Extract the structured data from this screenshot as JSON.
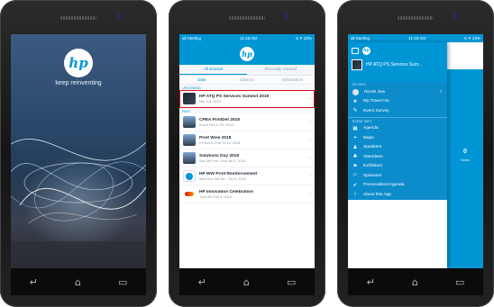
{
  "phone1": {
    "logo_text": "hp",
    "tagline": "keep reinventing",
    "nav": [
      "↵",
      "⌂",
      "▭"
    ]
  },
  "phone2": {
    "status_left": "all Sterling",
    "status_time": "11:49 AM",
    "status_right": "8 ✦ 23%",
    "logo_text": "hp",
    "tabs": [
      "All Events",
      "Recently Viewed"
    ],
    "subtabs": [
      "Date",
      "Distance",
      "Alphabetical"
    ],
    "upcoming_label": "UPCOMING",
    "past_label": "PAST",
    "upcoming": [
      {
        "title": "HP ATQ PS Services Summit 2019",
        "date": "Mar 4-8, 2019"
      }
    ],
    "past": [
      {
        "title": "CPEA PrintDel 2018",
        "date": "Event Feb 3-7th, 2018"
      },
      {
        "title": "Print Wise 2018",
        "date": "Fri Nov to Feb 19-14, 2018"
      },
      {
        "title": "Solutions Day 2018",
        "date": "Sep 3th Feb - Sep 4th 5, 2018"
      },
      {
        "title": "HP WW Print Reinforcement",
        "date": "Wed Nov Sat 9th - Oct 9, 2018"
      },
      {
        "title": "HP Innovation Celebration",
        "date": "Tues 5th Feb 4, 2019"
      }
    ],
    "nav": [
      "↵",
      "⌂",
      "▭"
    ]
  },
  "phone3": {
    "status_left": "all Sterling",
    "status_time": "11:49 AM",
    "status_right": "8 ✦ 23%",
    "logo_text": "hp",
    "event_name": "HP ATQ PS Services Sum...",
    "my_info_label": "MY INFO",
    "my_info_items": [
      {
        "label": "Nicole Jow",
        "icon": "avatar",
        "arrow": "›"
      },
      {
        "label": "My Travel Ins",
        "icon": "★"
      },
      {
        "label": "Event Survey",
        "icon": "✎"
      }
    ],
    "event_info_label": "EVENT INFO",
    "event_items": [
      {
        "label": "Agenda",
        "icon": "▦"
      },
      {
        "label": "Maps",
        "icon": "⌖"
      },
      {
        "label": "Speakers",
        "icon": "♟"
      },
      {
        "label": "Attendees",
        "icon": "♣"
      },
      {
        "label": "Exhibitors",
        "icon": "⚑"
      },
      {
        "label": "Sponsors",
        "icon": "⚐"
      },
      {
        "label": "Personalized Agenda",
        "icon": "✔"
      },
      {
        "label": "About this App",
        "icon": "i"
      }
    ],
    "notes_count": "0",
    "notes_label": "Notes",
    "nav": [
      "↵",
      "⌂",
      "▭"
    ]
  }
}
